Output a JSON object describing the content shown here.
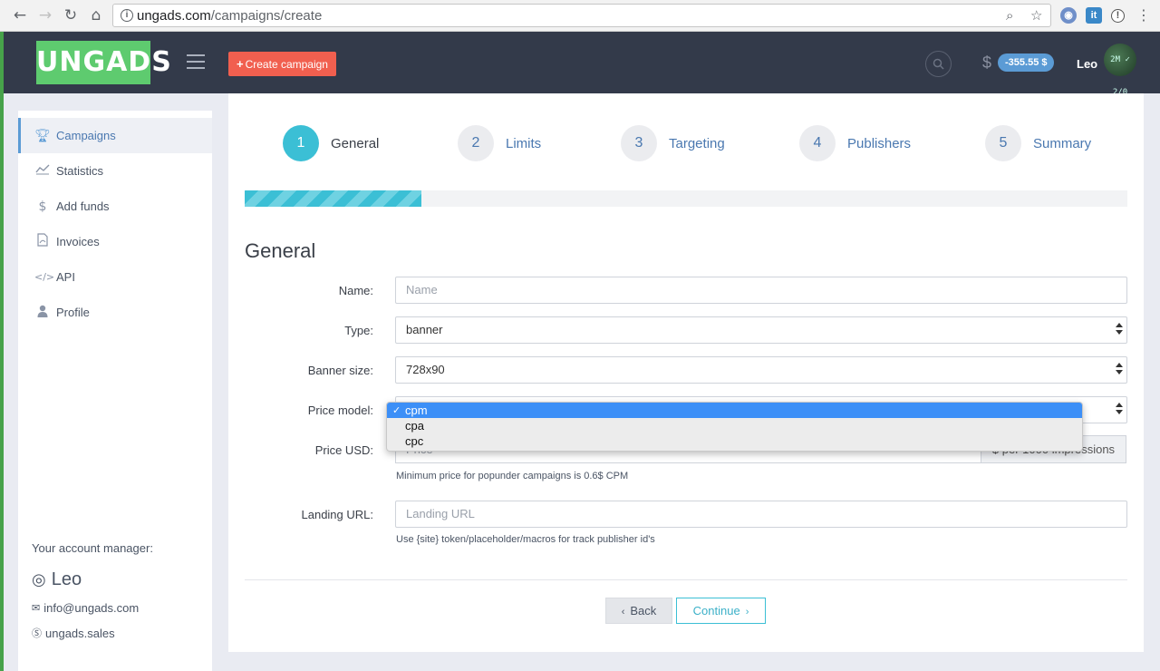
{
  "browser": {
    "url_host": "ungads.com",
    "url_path": "/campaigns/create"
  },
  "header": {
    "logo": "UNGADS",
    "create_label": "Create campaign",
    "currency_symbol": "$",
    "balance": "-355.55 $",
    "username": "Leo",
    "avatar_text": "2M ✓ 2/0"
  },
  "sidebar": {
    "items": [
      {
        "label": "Campaigns",
        "icon": "trophy-icon"
      },
      {
        "label": "Statistics",
        "icon": "chart-line-icon"
      },
      {
        "label": "Add funds",
        "icon": "dollar-icon"
      },
      {
        "label": "Invoices",
        "icon": "file-pdf-icon"
      },
      {
        "label": "API",
        "icon": "code-icon"
      },
      {
        "label": "Profile",
        "icon": "user-icon"
      }
    ],
    "manager": {
      "title": "Your account manager:",
      "name": "Leo",
      "email": "info@ungads.com",
      "skype": "ungads.sales"
    }
  },
  "steps": [
    {
      "num": "1",
      "label": "General"
    },
    {
      "num": "2",
      "label": "Limits"
    },
    {
      "num": "3",
      "label": "Targeting"
    },
    {
      "num": "4",
      "label": "Publishers"
    },
    {
      "num": "5",
      "label": "Summary"
    }
  ],
  "progress_fraction": 0.2,
  "form": {
    "title": "General",
    "name": {
      "label": "Name:",
      "placeholder": "Name"
    },
    "type": {
      "label": "Type:",
      "value": "banner"
    },
    "banner_size": {
      "label": "Banner size:",
      "value": "728x90"
    },
    "price_model": {
      "label": "Price model:",
      "options": [
        "cpm",
        "cpa",
        "cpc"
      ],
      "selected": "cpm"
    },
    "price": {
      "label": "Price USD:",
      "placeholder": "Price",
      "addon": "$ per 1000 impressions",
      "help": "Minimum price for popunder campaigns is 0.6$ CPM"
    },
    "landing": {
      "label": "Landing URL:",
      "placeholder": "Landing URL",
      "help": "Use {site} token/placeholder/macros for track publisher id's"
    },
    "back_label": "Back",
    "continue_label": "Continue"
  },
  "colors": {
    "accent": "#3bbfd5",
    "logo": "#5ecb6f",
    "create_button": "#f15f4f",
    "topbar": "#333a4a",
    "balance_badge": "#5b9bd5"
  }
}
